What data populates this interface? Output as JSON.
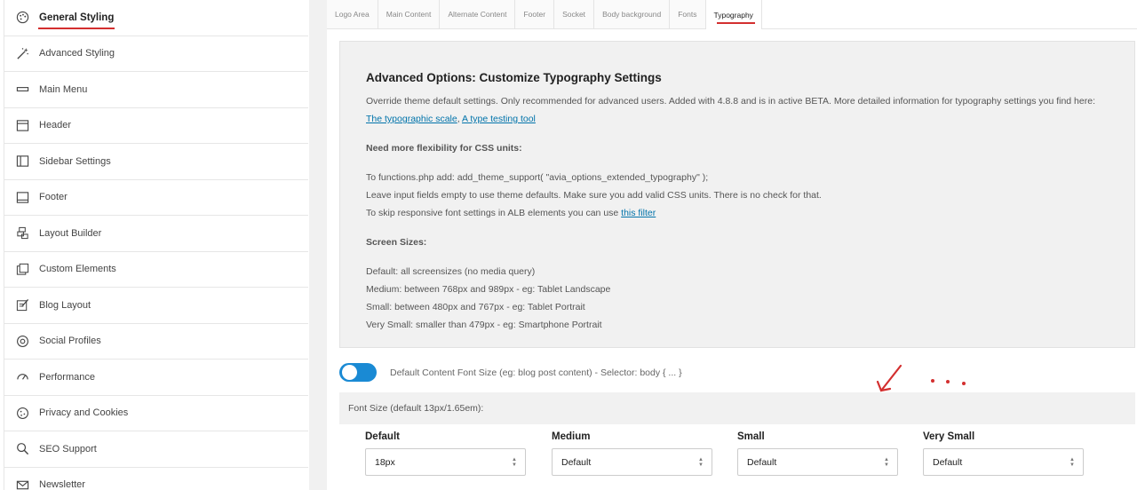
{
  "sidebar": {
    "items": [
      {
        "label": "General Styling",
        "icon": "palette-icon",
        "active": true
      },
      {
        "label": "Advanced Styling",
        "icon": "magic-wand-icon"
      },
      {
        "label": "Main Menu",
        "icon": "menu-bar-icon"
      },
      {
        "label": "Header",
        "icon": "header-layout-icon"
      },
      {
        "label": "Sidebar Settings",
        "icon": "sidebar-layout-icon"
      },
      {
        "label": "Footer",
        "icon": "footer-layout-icon"
      },
      {
        "label": "Layout Builder",
        "icon": "layout-builder-icon"
      },
      {
        "label": "Custom Elements",
        "icon": "custom-elements-icon"
      },
      {
        "label": "Blog Layout",
        "icon": "blog-edit-icon"
      },
      {
        "label": "Social Profiles",
        "icon": "social-at-icon"
      },
      {
        "label": "Performance",
        "icon": "speedometer-icon"
      },
      {
        "label": "Privacy and Cookies",
        "icon": "cookie-icon"
      },
      {
        "label": "SEO Support",
        "icon": "search-icon"
      },
      {
        "label": "Newsletter",
        "icon": "newsletter-icon"
      }
    ]
  },
  "tabs": [
    {
      "label": "Logo Area"
    },
    {
      "label": "Main Content"
    },
    {
      "label": "Alternate Content"
    },
    {
      "label": "Footer"
    },
    {
      "label": "Socket"
    },
    {
      "label": "Body background"
    },
    {
      "label": "Fonts"
    },
    {
      "label": "Typography",
      "active": true
    }
  ],
  "info": {
    "title": "Advanced Options: Customize Typography Settings",
    "intro": "Override theme default settings. Only recommended for advanced users. Added with 4.8.8 and is in active BETA. More detailed information for typography settings you find here:",
    "link1": "The typographic scale",
    "sep": ",",
    "link2": "A type testing tool",
    "css_heading": "Need more flexibility for CSS units:",
    "css_line1": "To functions.php add: add_theme_support( \"avia_options_extended_typography\" );",
    "css_line2": "Leave input fields empty to use theme defaults. Make sure you add valid CSS units. There is no check for that.",
    "css_line3": "To skip responsive font settings in ALB elements you can use",
    "filter_link": "this filter",
    "screen_heading": "Screen Sizes:",
    "screen_default": "Default: all screensizes (no media query)",
    "screen_medium": "Medium: between 768px and 989px - eg: Tablet Landscape",
    "screen_small": "Small: between 480px and 767px - eg: Tablet Portrait",
    "screen_verysmall": "Very Small: smaller than 479px - eg: Smartphone Portrait"
  },
  "toggle": {
    "label": "Default Content Font Size (eg: blog post content) - Selector: body { ... }",
    "on": true
  },
  "fontsize": {
    "heading": "Font Size (default 13px/1.65em):",
    "columns": [
      {
        "label": "Default",
        "value": "18px"
      },
      {
        "label": "Medium",
        "value": "Default"
      },
      {
        "label": "Small",
        "value": "Default"
      },
      {
        "label": "Very Small",
        "value": "Default"
      }
    ]
  },
  "colors": {
    "accent_red": "#d32f2f",
    "toggle_blue": "#1a8ad4",
    "link_blue": "#0073aa"
  }
}
